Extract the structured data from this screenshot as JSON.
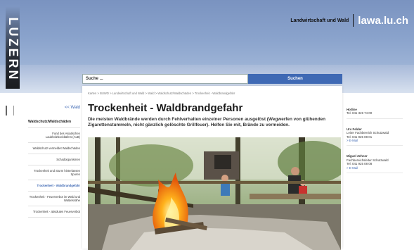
{
  "header": {
    "wordmark": "LUZERN",
    "department": "Landwirtschaft und Wald",
    "logo": "lawa.lu.ch"
  },
  "search": {
    "value": "Suche ...",
    "button_label": "Suchen"
  },
  "breadcrumb": "Karten  >  BUWD  >  Landwirtschaft und Wald  >  Wald  >  Waldschutz/Waldschäden  >  Trockenheit - Waldbrandgefahr",
  "leftnav": {
    "back_label": "<< Wald",
    "section_title": "Waldschutz/Waldschäden",
    "items": [
      "Fund des Asiatischen Laubholzbockkäfers (ALB)",
      "Waldschutz vermeldet Waldschäden",
      "Schadorganismen",
      "Trockenheit und Sturm hinterlassen Spuren",
      "Trockenheit - Waldbrandgefahr",
      "Trockenheit - Feuerverbot im Wald und Waldesnähe",
      "Trockenheit - absolutes Feuerverbot"
    ],
    "active_index": 4
  },
  "main": {
    "title": "Trockenheit - Waldbrandgefahr",
    "lead": "Die meisten Waldbrände werden durch Fehlverhalten einzelner Personen ausgelöst (Wegwerfen von glühenden Zigarettenstummeln, nicht gänzlich gelöschte Grillfeuer). Helfen Sie mit, Brände zu vermeiden."
  },
  "contacts": [
    {
      "title": "Hotline",
      "lines": [
        "Tel. 041 349 74 00"
      ],
      "link": ""
    },
    {
      "title": "Urs Felder",
      "lines": [
        "Leiter Fachbereich Schutzwald",
        "Tel. 041 925 08 01"
      ],
      "link": "> E-Mail"
    },
    {
      "title": "Miguel Zehner",
      "lines": [
        "Fachbereichsleiter Schutzwald",
        "Tel. 041 925 08 08"
      ],
      "link": "> E-Mail"
    }
  ],
  "colors": {
    "accent": "#3f69b4",
    "hero": "#8aa3cc"
  }
}
